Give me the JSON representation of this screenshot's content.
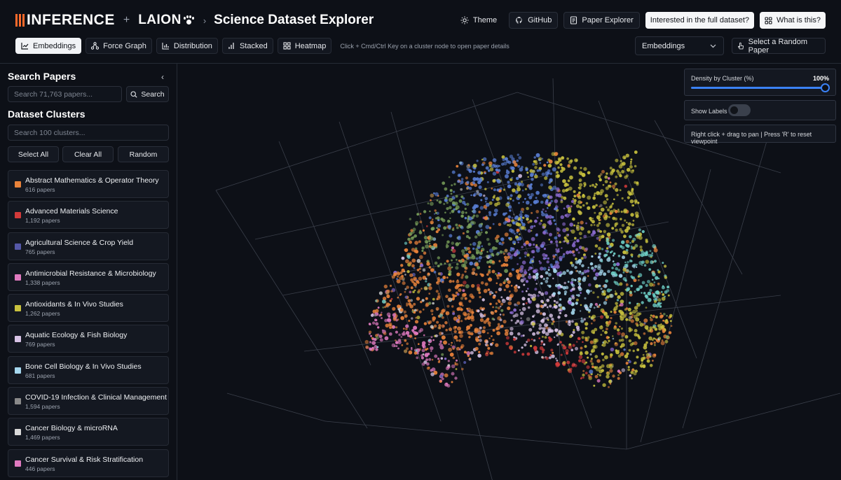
{
  "header": {
    "logo_inference": "INFERENCE",
    "logo_plus": "+",
    "logo_laion": "LAION",
    "crumb_sep": "›",
    "title": "Science Dataset Explorer",
    "actions": {
      "theme": "Theme",
      "github": "GitHub",
      "paper_explorer": "Paper Explorer",
      "full_dataset": "Interested in the full dataset?",
      "what_is_this": "What is this?"
    }
  },
  "tabs": [
    {
      "label": "Embeddings",
      "icon": "chart-icon",
      "active": true
    },
    {
      "label": "Force Graph",
      "icon": "network-icon",
      "active": false
    },
    {
      "label": "Distribution",
      "icon": "bar-chart-icon",
      "active": false
    },
    {
      "label": "Stacked",
      "icon": "stacked-chart-icon",
      "active": false
    },
    {
      "label": "Heatmap",
      "icon": "grid-icon",
      "active": false
    }
  ],
  "hint": "Click + Cmd/Ctrl Key on a cluster node to open paper details",
  "view_select": {
    "value": "Embeddings"
  },
  "random_paper": "Select a Random Paper",
  "sidebar": {
    "search_title": "Search Papers",
    "collapse": "‹",
    "search_placeholder": "Search 71,763 papers...",
    "search_button": "Search",
    "clusters_title": "Dataset Clusters",
    "cluster_placeholder": "Search 100 clusters...",
    "select_all": "Select All",
    "clear_all": "Clear All",
    "random": "Random",
    "clusters": [
      {
        "name": "Abstract Mathematics & Operator Theory",
        "count": "616 papers",
        "color": "#e8823a"
      },
      {
        "name": "Advanced Materials Science",
        "count": "1,192 papers",
        "color": "#d23a3a"
      },
      {
        "name": "Agricultural Science & Crop Yield",
        "count": "765 papers",
        "color": "#5558a8"
      },
      {
        "name": "Antimicrobial Resistance & Microbiology",
        "count": "1,338 papers",
        "color": "#e07ac0"
      },
      {
        "name": "Antioxidants & In Vivo Studies",
        "count": "1,262 papers",
        "color": "#c9c23e"
      },
      {
        "name": "Aquatic Ecology & Fish Biology",
        "count": "769 papers",
        "color": "#d8c3e6"
      },
      {
        "name": "Bone Cell Biology & In Vivo Studies",
        "count": "681 papers",
        "color": "#a6d8ef"
      },
      {
        "name": "COVID-19 Infection & Clinical Management",
        "count": "1,594 papers",
        "color": "#8a8a8a"
      },
      {
        "name": "Cancer Biology & microRNA",
        "count": "1,469 papers",
        "color": "#d9d9d9"
      },
      {
        "name": "Cancer Survival & Risk Stratification",
        "count": "446 papers",
        "color": "#e07ac0"
      }
    ]
  },
  "controls": {
    "density_label": "Density by Cluster (%)",
    "density_value": "100%",
    "density_fraction": 1.0,
    "show_labels": "Show Labels",
    "show_labels_on": false,
    "viewport_hint": "Right click + drag to pan | Press 'R' to reset viewpoint"
  }
}
